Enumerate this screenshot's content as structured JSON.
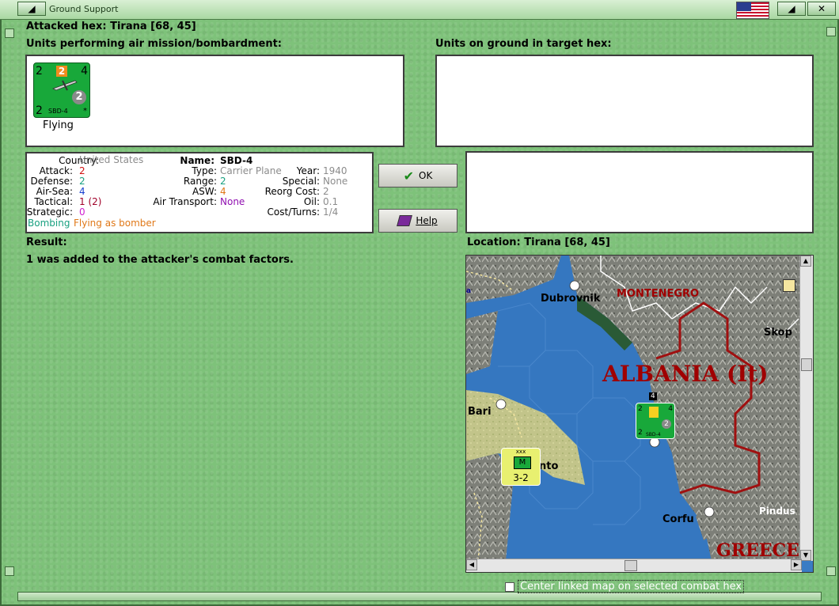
{
  "window": {
    "title": "Ground Support",
    "flag_icon": "us-flag-icon"
  },
  "attacked_hex": "Attacked hex: Tirana  [68, 45]",
  "air_units_label": "Units performing air mission/bombardment:",
  "ground_units_label": "Units on ground in target hex:",
  "air_unit": {
    "top_left": "2",
    "top_center": "2",
    "top_right": "4",
    "bottom_left": "2",
    "circle": "2",
    "name": "SBD-4",
    "star": "*",
    "caption": "Flying",
    "color": "#18a83a"
  },
  "info": {
    "country_k": "Country:",
    "country_v": "United States",
    "attack_k": "Attack:",
    "attack_v": "2",
    "defense_k": "Defense:",
    "defense_v": "2",
    "airsea_k": "Air-Sea:",
    "airsea_v": "4",
    "tactical_k": "Tactical:",
    "tactical_v": "1 (2)",
    "strategic_k": "Strategic:",
    "strategic_v": "0",
    "bombing": "Bombing",
    "flying_as": "Flying as bomber",
    "name_k": "Name:",
    "name_v": "SBD-4",
    "type_k": "Type:",
    "type_v": "Carrier Plane",
    "range_k": "Range:",
    "range_v": "2",
    "asw_k": "ASW:",
    "asw_v": "4",
    "airtrans_k": "Air Transport:",
    "airtrans_v": "None",
    "year_k": "Year:",
    "year_v": "1940",
    "special_k": "Special:",
    "special_v": "None",
    "reorg_k": "Reorg Cost:",
    "reorg_v": "2",
    "oil_k": "Oil:",
    "oil_v": "0.1",
    "cost_k": "Cost/Turns:",
    "cost_v": "1/4"
  },
  "buttons": {
    "ok": "OK",
    "help": "Help"
  },
  "result_label": "Result:",
  "result_text": "1 was added to the attacker's combat factors.",
  "location_label": "Location:  Tirana  [68, 45]",
  "map": {
    "labels": {
      "dubrovnik": "Dubrovnik",
      "montenegro": "MONTENEGRO",
      "albania": "ALBANIA (It)",
      "skop": "Skop",
      "bari": "Bari",
      "taranto": "nto",
      "corfu": "Corfu",
      "pindus": "Pindus I",
      "greece": "GREECE",
      "a_fragment": "a"
    },
    "map_unit": {
      "tl": "2",
      "tr": "4",
      "top_badge": "4",
      "bl": "2",
      "circle": "2",
      "name": "SBD-4"
    },
    "italian_unit": {
      "size": "xxx",
      "type": "M",
      "strength": "3-2",
      "side": "Italy"
    }
  },
  "center_checkbox": "Center linked map on selected combat hex"
}
